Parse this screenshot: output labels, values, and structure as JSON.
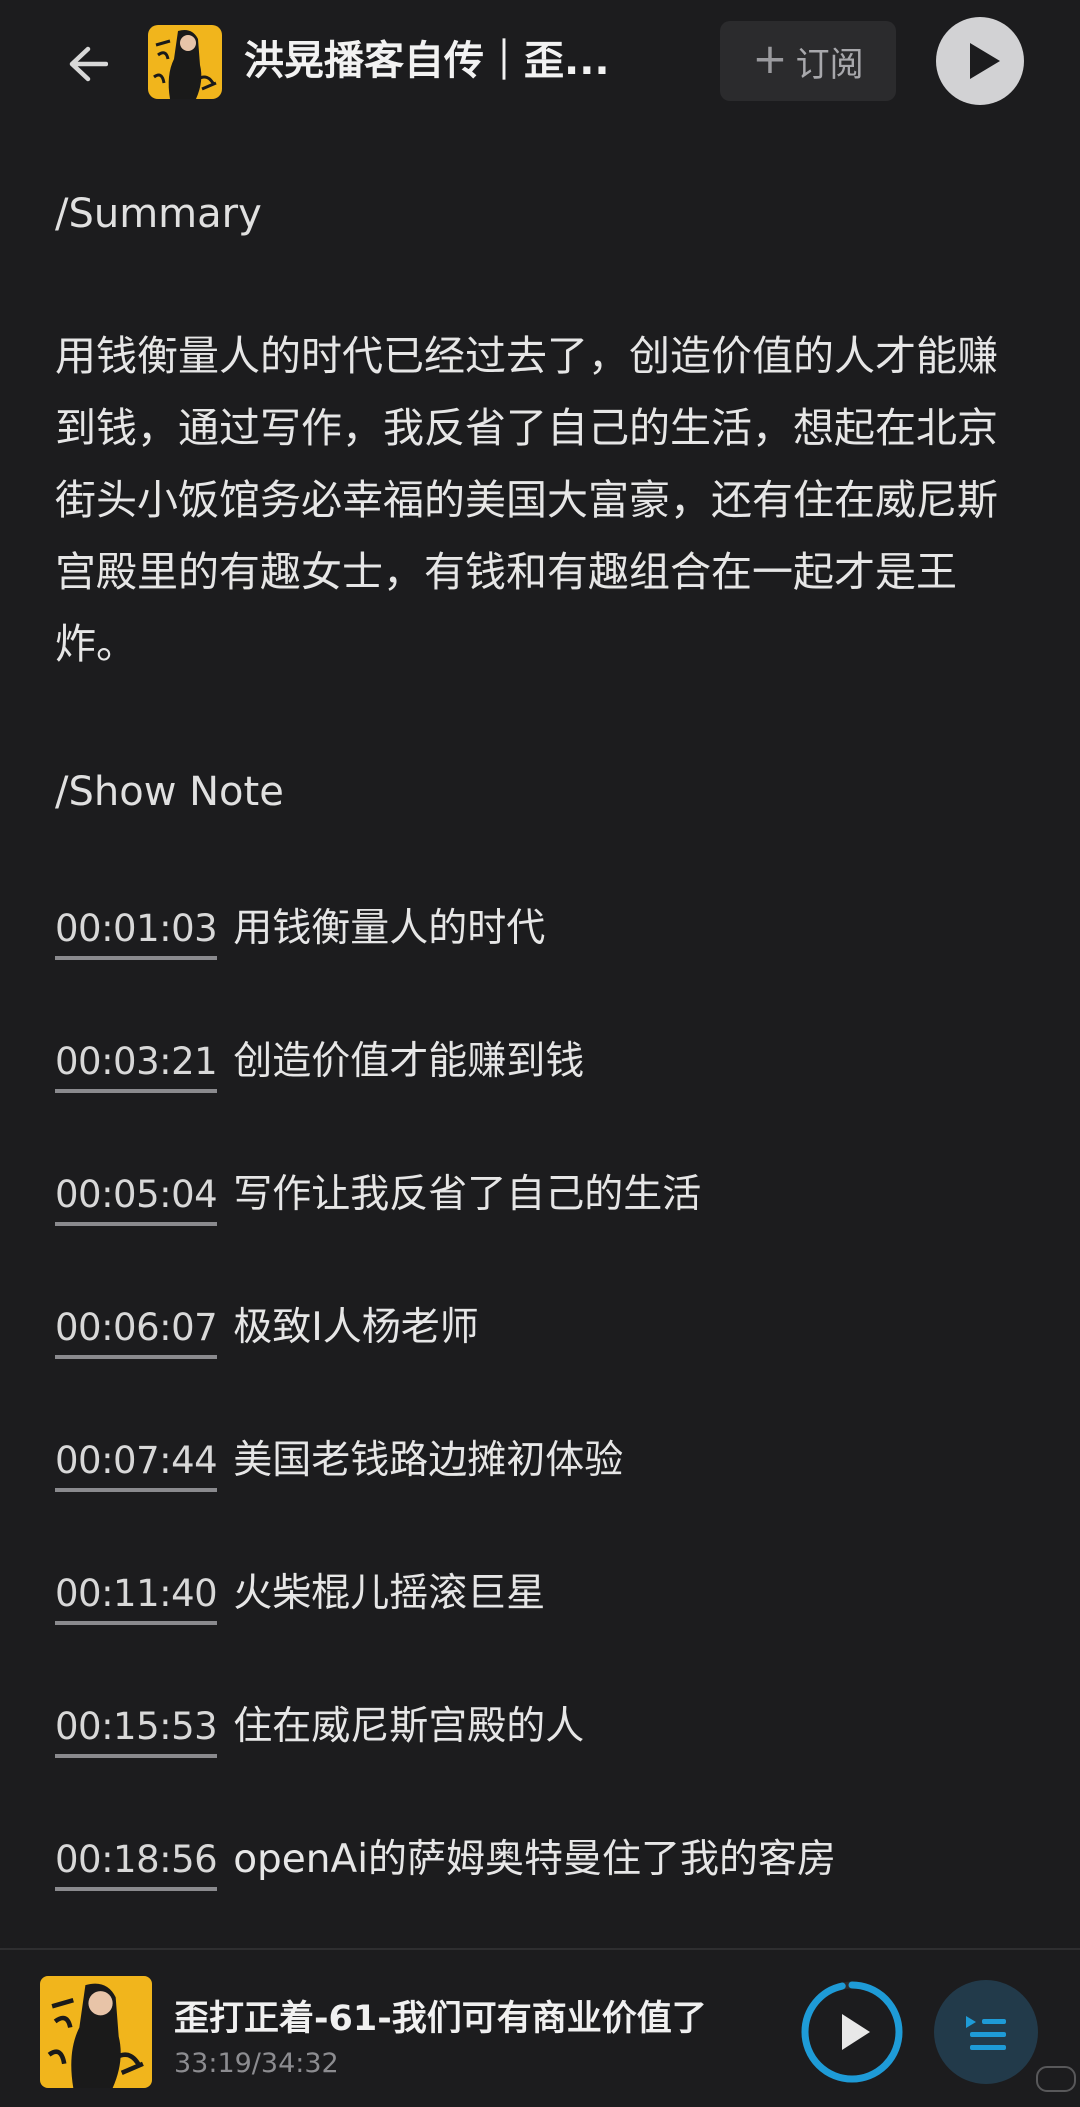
{
  "header": {
    "title": "洪晃播客自传｜歪...",
    "subscribe_icon": "+",
    "subscribe_label": "订阅"
  },
  "summary": {
    "heading": "/Summary",
    "text": "用钱衡量人的时代已经过去了，创造价值的人才能赚到钱，通过写作，我反省了自己的生活，想起在北京街头小饭馆务必幸福的美国大富豪，还有住在威尼斯宫殿里的有趣女士，有钱和有趣组合在一起才是王炸。"
  },
  "show_note": {
    "heading": "/Show Note",
    "items": [
      {
        "time": "00:01:03",
        "text": "用钱衡量人的时代"
      },
      {
        "time": "00:03:21",
        "text": "创造价值才能赚到钱"
      },
      {
        "time": "00:05:04",
        "text": "写作让我反省了自己的生活"
      },
      {
        "time": "00:06:07",
        "text": "极致I人杨老师"
      },
      {
        "time": "00:07:44",
        "text": "美国老钱路边摊初体验"
      },
      {
        "time": "00:11:40",
        "text": "火柴棍儿摇滚巨星"
      },
      {
        "time": "00:15:53",
        "text": "住在威尼斯宫殿的人"
      },
      {
        "time": "00:18:56",
        "text": "openAi的萨姆奥特曼住了我的客房"
      }
    ]
  },
  "player": {
    "title": "歪打正着-61-我们可有商业价值了",
    "time": "33:19/34:32",
    "progress": 0.965
  },
  "colors": {
    "background": "#1c1c1e",
    "accent": "#1e9bd7",
    "cover": "#f1b51c"
  }
}
